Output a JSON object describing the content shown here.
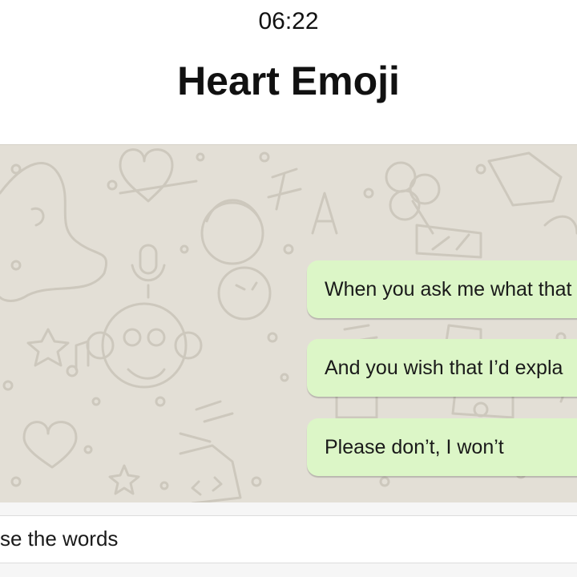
{
  "status_bar": {
    "time": "06:22"
  },
  "header": {
    "title": "Heart Emoji"
  },
  "chat": {
    "messages": [
      {
        "text": "When you ask me what that"
      },
      {
        "text": "And you wish that I’d expla"
      },
      {
        "text": "Please don’t, I won’t"
      }
    ]
  },
  "composer": {
    "text": "se the words"
  },
  "colors": {
    "chat_background": "#e3dfd6",
    "outgoing_bubble": "#dcf6c7",
    "doodle_stroke": "#cdc8bd"
  }
}
